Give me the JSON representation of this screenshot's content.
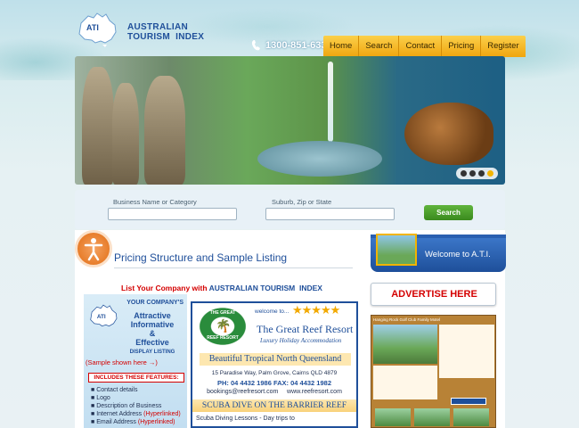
{
  "brand": {
    "abbr": "ATI",
    "name_line1": "AUSTRALIAN",
    "name_line2": "TOURISM  INDEX"
  },
  "header": {
    "phone": "1300-851-633"
  },
  "nav": [
    "Home",
    "Search",
    "Contact",
    "Pricing",
    "Register"
  ],
  "search": {
    "business_label": "Business Name or Category",
    "suburb_label": "Suburb, Zip or State",
    "button_label": "Search"
  },
  "page": {
    "title": "Pricing Structure and Sample Listing"
  },
  "ad": {
    "top_red": "List Your Company with",
    "top_blue": "AUSTRALIAN TOURISM  INDEX",
    "your_company": "YOUR COMPANY'S",
    "attractive": "Attractive",
    "informative": "Informative",
    "amp": "&",
    "effective": "Effective",
    "display_listing": "DISPLAY LISTING",
    "sample_shown": "(Sample shown here",
    "sample_arrow": "→)",
    "includes": "INCLUDES THESE FEATURES:",
    "features": [
      {
        "text": "Contact details",
        "note": ""
      },
      {
        "text": "Logo",
        "note": ""
      },
      {
        "text": "Description of Business",
        "note": ""
      },
      {
        "text": "Internet Address",
        "note": "(Hyperlinked)"
      },
      {
        "text": "Email Address",
        "note": "(Hyperlinked)"
      }
    ],
    "resort_logo_line1": "THE GREAT",
    "resort_logo_line2": "REEF RESORT",
    "welcome_to": "welcome to...",
    "stars": "★★★★★",
    "resort_name": "The Great Reef Resort",
    "resort_tagline": "Luxury Holiday Accommodation",
    "region": "Beautiful Tropical North Queensland",
    "address": "15 Paradise Way, Palm Grove, Cairns QLD 4879",
    "phones": "PH: 04 4432 1986   FAX: 04 4432 1982",
    "emails": "bookings@reefresort.com     www.reefresort.com",
    "scuba_title": "SCUBA DIVE ON THE BARRIER REEF",
    "scuba_desc": "Scuba Diving Lessons - Day trips to"
  },
  "sidebar": {
    "welcome": "Welcome to A.T.I.",
    "advertise": "ADVERTISE HERE",
    "listing_title": "Hanging Rock Golf Club Family Motel"
  },
  "colors": {
    "brand_blue": "#1f4f9a",
    "nav_orange": "#f0a50e",
    "accent_red": "#d40000",
    "search_green": "#4a9e2a"
  }
}
